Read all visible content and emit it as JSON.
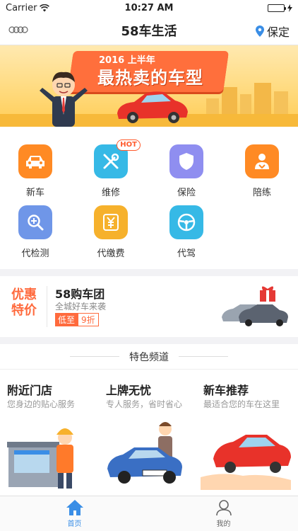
{
  "status_bar": {
    "carrier": "Carrier",
    "time": "10:27 AM"
  },
  "navbar": {
    "title": "58车生活",
    "location": "保定"
  },
  "banner": {
    "year_text": "2016 上半年",
    "headline": "最热卖的车型"
  },
  "services": [
    {
      "label": "新车",
      "icon": "car-icon",
      "color": "#ff8a24"
    },
    {
      "label": "维修",
      "icon": "wrench-screwdriver-icon",
      "color": "#36b9e6",
      "badge": "HOT"
    },
    {
      "label": "保险",
      "icon": "shield-icon",
      "color": "#8f8ef0"
    },
    {
      "label": "陪练",
      "icon": "driver-icon",
      "color": "#ff8a24"
    },
    {
      "label": "代检测",
      "icon": "magnifier-plus-icon",
      "color": "#6f96e8"
    },
    {
      "label": "代缴费",
      "icon": "yen-icon",
      "color": "#f6b12c"
    },
    {
      "label": "代驾",
      "icon": "steering-wheel-icon",
      "color": "#36b9e6"
    }
  ],
  "group_buy": {
    "badge_line1": "优惠",
    "badge_line2": "特价",
    "title": "58购车团",
    "subtitle": "全城好车来袭",
    "price_tag": "低至",
    "discount": "9折"
  },
  "featured": {
    "header": "特色频道",
    "cards": [
      {
        "title": "附近门店",
        "subtitle": "您身边的贴心服务"
      },
      {
        "title": "上牌无忧",
        "subtitle": "专人服务，省时省心"
      },
      {
        "title": "新车推荐",
        "subtitle": "最适合您的车在这里"
      }
    ]
  },
  "tabbar": {
    "tabs": [
      {
        "label": "首页",
        "icon": "home-icon",
        "active": true
      },
      {
        "label": "我的",
        "icon": "user-icon",
        "active": false
      }
    ]
  },
  "colors": {
    "accent": "#ff6a3d",
    "tab_active": "#3a8ee6"
  }
}
